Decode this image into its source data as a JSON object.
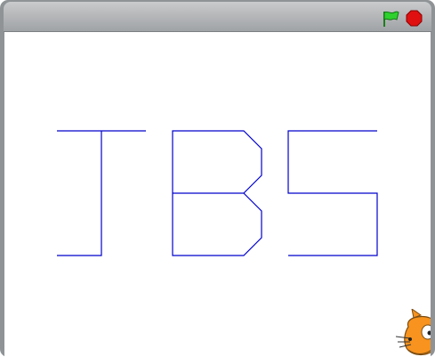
{
  "player": {
    "title": ""
  },
  "controls": {
    "green_flag_icon": "green-flag-icon",
    "stop_icon": "stop-sign-icon",
    "flag_color": "#22cc22",
    "stop_color": "#dd1111"
  },
  "stage": {
    "background": "#ffffff",
    "pen_color": "#0000cc",
    "drawn_text": "TBS"
  },
  "sprite": {
    "name": "cat-sprite-icon",
    "color": "#f7931e"
  }
}
